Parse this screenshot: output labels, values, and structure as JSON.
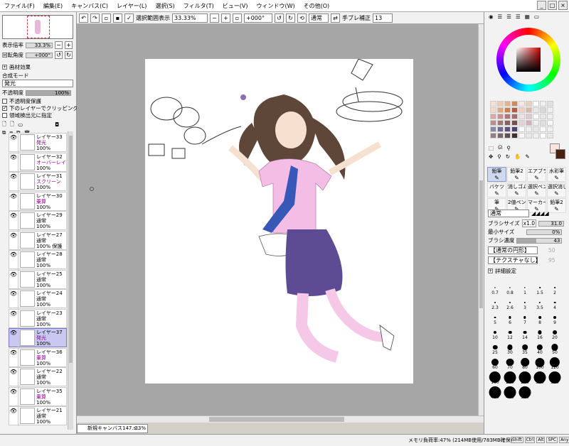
{
  "menubar": {
    "items": [
      "ファイル(F)",
      "編集(E)",
      "キャンバス(C)",
      "レイヤー(L)",
      "選択(S)",
      "フィルタ(T)",
      "ビュー(V)",
      "ウィンドウ(W)",
      "その他(O)"
    ],
    "window_buttons": [
      "_",
      "□",
      "×"
    ]
  },
  "toolbar": {
    "selection_label": "選択範囲表示",
    "zoom": "33.33%",
    "rotation": "+000°",
    "blend_mode": "通常",
    "stabilizer_label": "手ブレ補正",
    "stabilizer_value": "13"
  },
  "left_panel": {
    "zoom_label": "表示倍率",
    "zoom_value": "33.3%",
    "angle_label": "回転角度",
    "angle_value": "+000°",
    "texture_label": "画材効果",
    "blend_label": "合成モード",
    "blend_value": "発光",
    "opacity_label": "不透明度",
    "opacity_value": "100%",
    "opacity_fraction": 1.0,
    "checkbox_protect": "不透明度保護",
    "checkbox_clip": "下のレイヤーでクリッピング",
    "checkbox_source": "領域検出元に指定",
    "layers": [
      {
        "name": "レイヤー33",
        "mode": "発光",
        "opacity": "100%",
        "red": true,
        "selected": false
      },
      {
        "name": "レイヤー32",
        "mode": "オーバーレイ",
        "opacity": "100%",
        "red": true,
        "selected": false
      },
      {
        "name": "レイヤー31",
        "mode": "スクリーン",
        "opacity": "100%",
        "red": true,
        "selected": false
      },
      {
        "name": "レイヤー30",
        "mode": "乗算",
        "opacity": "100%",
        "red": true,
        "selected": false
      },
      {
        "name": "レイヤー29",
        "mode": "通常",
        "opacity": "100%",
        "red": true,
        "selected": false
      },
      {
        "name": "レイヤー27",
        "mode": "通常",
        "opacity": "100% 保護",
        "red": false,
        "selected": false
      },
      {
        "name": "レイヤー28",
        "mode": "通常",
        "opacity": "100%",
        "red": false,
        "selected": false
      },
      {
        "name": "レイヤー25",
        "mode": "通常",
        "opacity": "100%",
        "red": false,
        "selected": false
      },
      {
        "name": "レイヤー24",
        "mode": "通常",
        "opacity": "100%",
        "red": false,
        "selected": false
      },
      {
        "name": "レイヤー23",
        "mode": "通常",
        "opacity": "100%",
        "red": false,
        "selected": false
      },
      {
        "name": "レイヤー37",
        "mode": "発光",
        "opacity": "100%",
        "red": false,
        "selected": true
      },
      {
        "name": "レイヤー36",
        "mode": "乗算",
        "opacity": "100%",
        "red": true,
        "selected": false
      },
      {
        "name": "レイヤー22",
        "mode": "通常",
        "opacity": "100%",
        "red": false,
        "selected": false
      },
      {
        "name": "レイヤー35",
        "mode": "乗算",
        "opacity": "100%",
        "red": true,
        "selected": false
      },
      {
        "name": "レイヤー21",
        "mode": "通常",
        "opacity": "100%",
        "red": false,
        "selected": false
      }
    ]
  },
  "right_panel": {
    "tools": [
      "鉛筆",
      "鉛筆2",
      "エアブラシ",
      "水彩筆",
      "バケツ",
      "消しゴム",
      "選択ペン",
      "選択消し",
      "筆",
      "2値ペン",
      "マーカー",
      "鉛筆2"
    ],
    "brush_mode": "通常",
    "size_label": "ブラシサイズ",
    "size_multiplier": "x1.0",
    "size_value": "31.0",
    "min_size_label": "最小サイズ",
    "min_size_value": "0%",
    "density_label": "ブラシ濃度",
    "density_value": "43",
    "density_fraction": 0.43,
    "shape_label": "【通常の円形】",
    "shape_value": "50",
    "texture_label": "【テクスチャなし】",
    "texture_value": "95",
    "detail_label": "詳細設定",
    "brush_sizes": [
      "0.7",
      "0.8",
      "1",
      "1.5",
      "2",
      "2.3",
      "2.6",
      "3",
      "3.5",
      "4",
      "5",
      "6",
      "7",
      "8",
      "9",
      "10",
      "12",
      "14",
      "16",
      "20",
      "25",
      "30",
      "35",
      "40",
      "50",
      "60",
      "70",
      "80",
      "100",
      "120",
      "160",
      "200",
      "250",
      "300",
      "350",
      "400",
      "450",
      "500"
    ]
  },
  "canvas": {
    "doc_tab": "新規キャンバス147.s...",
    "doc_zoom": "33%"
  },
  "status": {
    "memory": "メモリ負荷率:47% (214MB使用/783MB確保)",
    "keys": [
      "Shift",
      "Ctrl",
      "Alt",
      "SPC",
      "Any"
    ]
  }
}
